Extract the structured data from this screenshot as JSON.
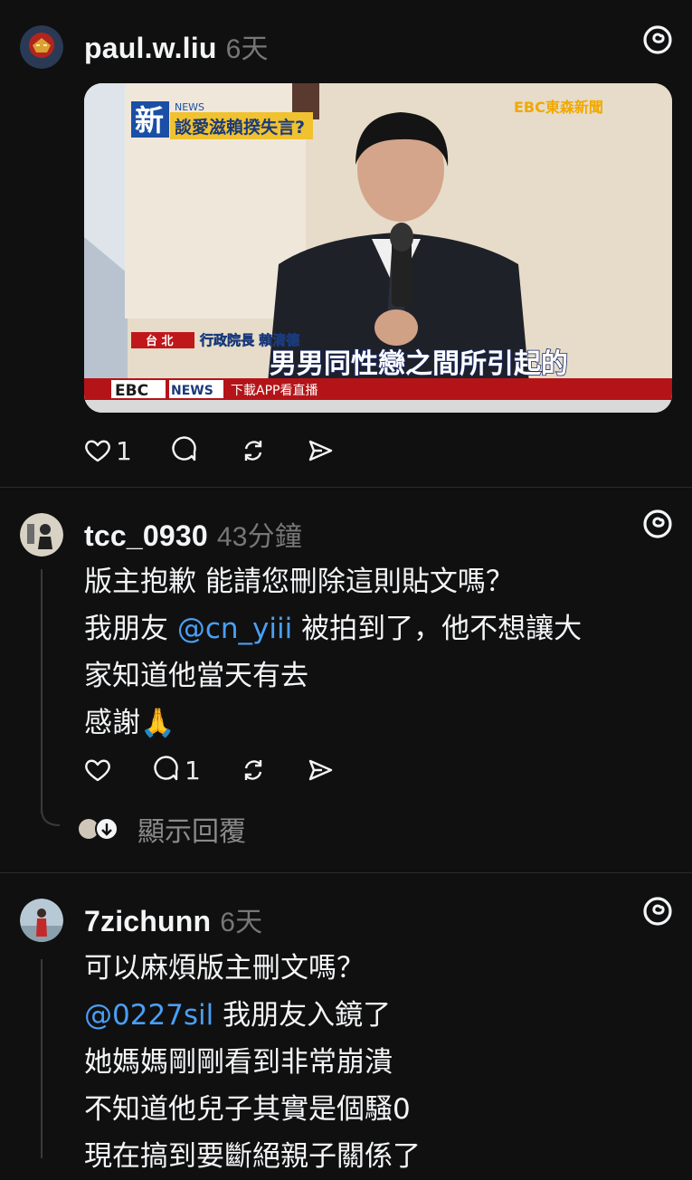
{
  "posts": [
    {
      "username": "paul.w.liu",
      "time": "6天",
      "media": {
        "tag_new": "新",
        "tag_news": "NEWS",
        "headline_top": "談愛滋賴揆失言?",
        "network_logo": "EBC東森新聞",
        "location": "台 北",
        "speaker": "行政院長 賴清德",
        "subtitle": "男男同性戀之間所引起的",
        "ticker_logo": "EBC",
        "ticker_news": "NEWS",
        "ticker_text": "下載APP看直播"
      },
      "likes": "1",
      "replies": "",
      "colors": {
        "bg": "#101010"
      }
    },
    {
      "username": "tcc_0930",
      "time": "43分鐘",
      "lines": [
        {
          "text": "版主抱歉 能請您刪除這則貼文嗎？"
        },
        {
          "pre": "我朋友 ",
          "mention": "@cn_yiii",
          "post": " 被拍到了，他不想讓大"
        },
        {
          "text": "家知道他當天有去"
        },
        {
          "text": "感謝🙏"
        }
      ],
      "likes": "",
      "replies": "1",
      "show_replies": "顯示回覆"
    },
    {
      "username": "7zichunn",
      "time": "6天",
      "lines": [
        {
          "text": "可以麻煩版主刪文嗎？"
        },
        {
          "mention": "@0227sil",
          "post": " 我朋友入鏡了"
        },
        {
          "text": "她媽媽剛剛看到非常崩潰"
        },
        {
          "text": "不知道他兒子其實是個騷0"
        },
        {
          "text": "現在搞到要斷絕親子關係了"
        }
      ]
    }
  ],
  "icons": {
    "threads": "threads-logo-icon",
    "like": "heart-icon",
    "reply": "comment-icon",
    "repost": "repost-icon",
    "share": "send-icon"
  }
}
